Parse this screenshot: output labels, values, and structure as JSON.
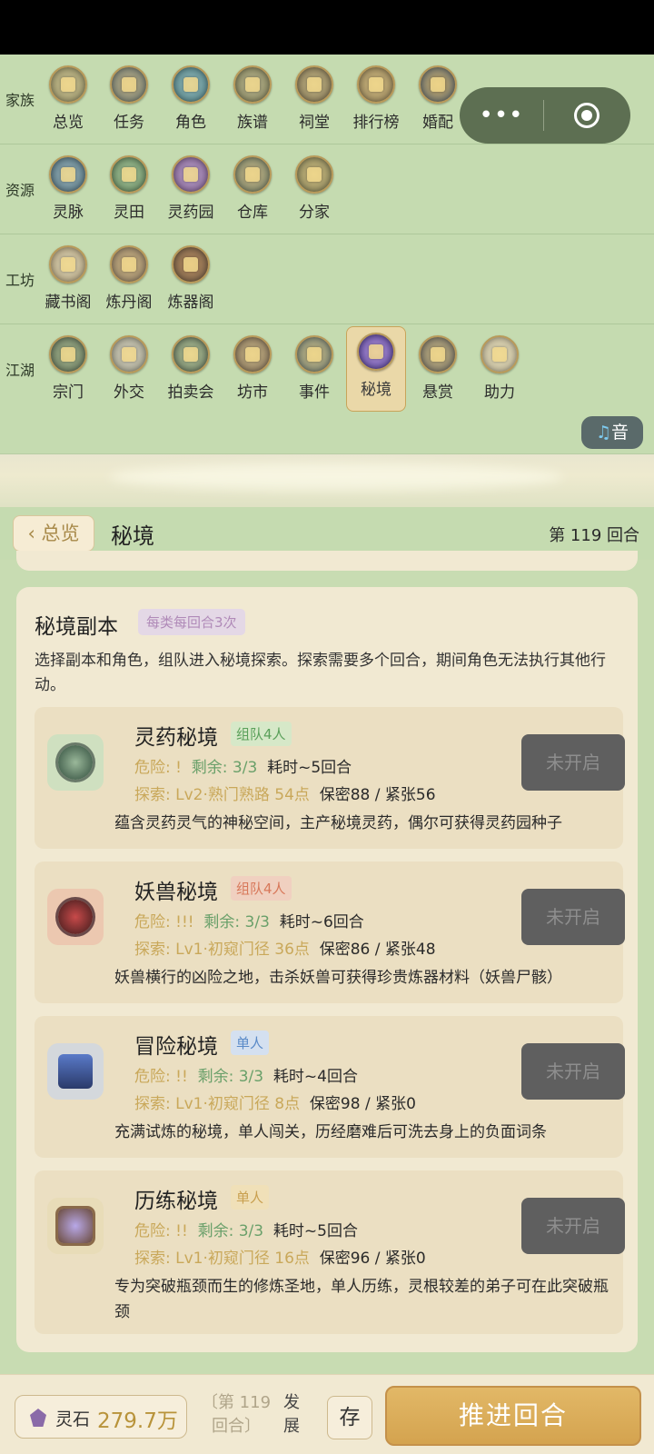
{
  "nav": {
    "rows": [
      {
        "label": "家族",
        "items": [
          {
            "label": "总览",
            "icon": "overview-icon"
          },
          {
            "label": "任务",
            "icon": "task-icon"
          },
          {
            "label": "角色",
            "icon": "character-icon"
          },
          {
            "label": "族谱",
            "icon": "family-tree-icon"
          },
          {
            "label": "祠堂",
            "icon": "shrine-icon"
          },
          {
            "label": "排行榜",
            "icon": "leaderboard-icon"
          },
          {
            "label": "婚配",
            "icon": "marriage-icon"
          }
        ]
      },
      {
        "label": "资源",
        "items": [
          {
            "label": "灵脉",
            "icon": "spirit-vein-icon"
          },
          {
            "label": "灵田",
            "icon": "spirit-field-icon"
          },
          {
            "label": "灵药园",
            "icon": "herb-garden-icon"
          },
          {
            "label": "仓库",
            "icon": "warehouse-icon"
          },
          {
            "label": "分家",
            "icon": "branch-family-icon"
          }
        ]
      },
      {
        "label": "工坊",
        "items": [
          {
            "label": "藏书阁",
            "icon": "library-icon"
          },
          {
            "label": "炼丹阁",
            "icon": "alchemy-icon"
          },
          {
            "label": "炼器阁",
            "icon": "forge-icon"
          }
        ]
      },
      {
        "label": "江湖",
        "items": [
          {
            "label": "宗门",
            "icon": "sect-icon"
          },
          {
            "label": "外交",
            "icon": "diplomacy-icon"
          },
          {
            "label": "拍卖会",
            "icon": "auction-icon"
          },
          {
            "label": "坊市",
            "icon": "market-icon"
          },
          {
            "label": "事件",
            "icon": "event-icon"
          },
          {
            "label": "秘境",
            "icon": "secret-realm-icon"
          },
          {
            "label": "悬赏",
            "icon": "bounty-icon"
          },
          {
            "label": "助力",
            "icon": "assist-icon"
          }
        ]
      }
    ],
    "sound_label": "音"
  },
  "header": {
    "back_label": "总览",
    "title": "秘境",
    "turn": "第 119 回合"
  },
  "card": {
    "title": "秘境副本",
    "badge": "每类每回合3次",
    "description": "选择副本和角色，组队进入秘境探索。探索需要多个回合，期间角色无法执行其他行动。",
    "dungeons": [
      {
        "name": "灵药秘境",
        "tag": "组队4人",
        "danger": "危险: !",
        "remaining": "剩余: 3/3",
        "duration": "耗时~5回合",
        "explore": "探索: Lv2·熟门熟路 54点",
        "secrecy": "保密88 / 紧张56",
        "desc": "蕴含灵药灵气的神秘空间，主产秘境灵药，偶尔可获得灵药园种子",
        "button": "未开启"
      },
      {
        "name": "妖兽秘境",
        "tag": "组队4人",
        "danger": "危险: !!!",
        "remaining": "剩余: 3/3",
        "duration": "耗时~6回合",
        "explore": "探索: Lv1·初窥门径 36点",
        "secrecy": "保密86 / 紧张48",
        "desc": "妖兽横行的凶险之地，击杀妖兽可获得珍贵炼器材料（妖兽尸骸）",
        "button": "未开启"
      },
      {
        "name": "冒险秘境",
        "tag": "单人",
        "danger": "危险: !!",
        "remaining": "剩余: 3/3",
        "duration": "耗时~4回合",
        "explore": "探索: Lv1·初窥门径 8点",
        "secrecy": "保密98 / 紧张0",
        "desc": "充满试炼的秘境，单人闯关，历经磨难后可洗去身上的负面词条",
        "button": "未开启"
      },
      {
        "name": "历练秘境",
        "tag": "单人",
        "danger": "危险: !!",
        "remaining": "剩余: 3/3",
        "duration": "耗时~5回合",
        "explore": "探索: Lv1·初窥门径 16点",
        "secrecy": "保密96 / 紧张0",
        "desc": "专为突破瓶颈而生的修炼圣地，单人历练，灵根较差的弟子可在此突破瓶颈",
        "button": "未开启"
      }
    ]
  },
  "bottom": {
    "stone_label": "灵石",
    "stone_value": "279.7万",
    "turn_info": "〔第 119 回合〕",
    "develop_label": "发展",
    "save_label": "存",
    "advance_label": "推进回合"
  },
  "colors": {
    "background": "#c8dcb2",
    "card": "#f1e9d2",
    "accent_gold": "#d4a34f",
    "danger_text": "#c9a85a",
    "remain_text": "#6aa06a",
    "disabled_button": "#5f5f5f"
  }
}
